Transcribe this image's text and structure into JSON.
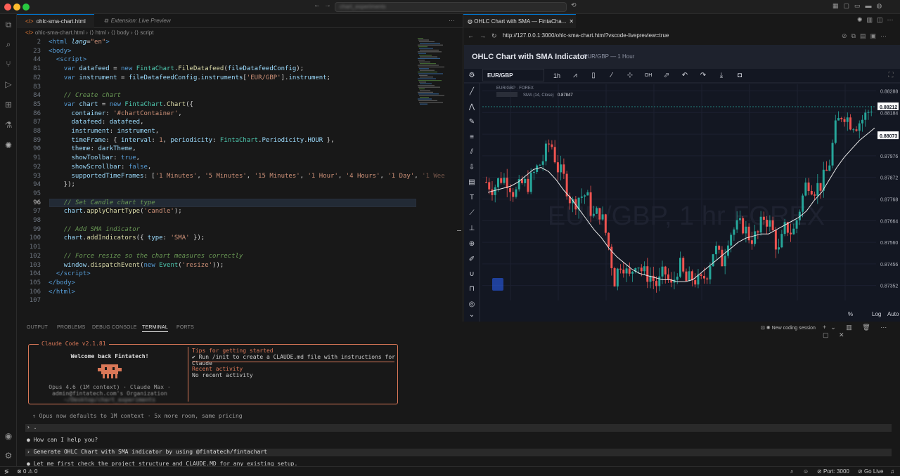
{
  "titlebar": {
    "search_text": "chart_experiments"
  },
  "editor": {
    "tabs": [
      {
        "label": "ohlc-sma-chart.html"
      },
      {
        "label": "Extension: Live Preview"
      }
    ],
    "breadcrumb": {
      "file": "ohlc-sma-chart.html",
      "html": "html",
      "body": "body",
      "script": "script"
    },
    "line_numbers": [
      "2",
      "23",
      "44",
      "81",
      "82",
      "83",
      "84",
      "85",
      "86",
      "87",
      "88",
      "89",
      "90",
      "91",
      "92",
      "93",
      "94",
      "95",
      "96",
      "97",
      "98",
      "99",
      "100",
      "101",
      "102",
      "103",
      "104",
      "105",
      "106",
      "107"
    ]
  },
  "panel": {
    "tabs": [
      "OUTPUT",
      "PROBLEMS",
      "DEBUG CONSOLE",
      "TERMINAL",
      "PORTS"
    ],
    "active_tab": "TERMINAL",
    "session_label": "New coding session"
  },
  "terminal": {
    "box_title": "Claude Code v2.1.81",
    "welcome": "Welcome back Fintatech!",
    "model": "Opus 4.6 (1M context) · Claude Max ·",
    "org": "admin@fintatech.com's Organization",
    "path": "~/Desktop/chart_experiments",
    "tips_title": "Tips for getting started",
    "tips_line": "✔ Run /init to create a CLAUDE.md file with instructions for Claude",
    "recent_title": "Recent activity",
    "recent_line": "No recent activity",
    "notice": "↑ Opus now defaults to 1M context · 5x more room, same pricing",
    "prompt_dot": "›  .",
    "q1": "●  How can I help you?",
    "prompt2": "›  Generate OHLC Chart with SMA indicator by using @fintatech/fintachart",
    "a1": "●  Let me first check the project structure and CLAUDE.MD for any existing setup."
  },
  "preview": {
    "tab_label": "OHLC Chart with SMA — FintaCha...",
    "url": "http://127.0.0.1:3000/ohlc-sma-chart.html?vscode-livepreview=true",
    "page_title": "OHLC Chart with SMA Indicator",
    "page_sub": "EUR/GBP — 1 Hour"
  },
  "chart_data": {
    "type": "candlestick",
    "symbol": "EUR/GBP",
    "timeframe": "1h",
    "legend_title": "EUR/GBP · FOREX",
    "indicator_label": "SMA (14, Close)",
    "indicator_value": "0.87847",
    "watermark": "EUR/GBP, 1 hr FOREX",
    "y_ticks": [
      "0.88288",
      "0.88184",
      "0.88080",
      "0.87976",
      "0.87872",
      "0.87768",
      "0.87664",
      "0.87560",
      "0.87456",
      "0.87352"
    ],
    "y_ticks_visible": [
      "0.88288",
      "0.88184",
      "0.87976",
      "0.87872",
      "0.87768",
      "0.87664",
      "0.87560",
      "0.87456",
      "0.87352"
    ],
    "last_price": "0.88212",
    "cursor_price": "0.88073",
    "ylim": [
      0.8728,
      0.8832
    ],
    "scale_buttons": [
      "%",
      "Log",
      "Auto"
    ],
    "close_path": [
      0.8785,
      0.8782,
      0.8787,
      0.8786,
      0.8779,
      0.8784,
      0.8784,
      0.8791,
      0.8796,
      0.8805,
      0.8792,
      0.8786,
      0.8774,
      0.8778,
      0.8779,
      0.8768,
      0.8771,
      0.8757,
      0.8738,
      0.8748,
      0.8738,
      0.8748,
      0.8741,
      0.874,
      0.8735,
      0.8742,
      0.8734,
      0.8746,
      0.8737,
      0.8739,
      0.8736,
      0.8742,
      0.8754,
      0.8746,
      0.876,
      0.8763,
      0.8764,
      0.8758,
      0.8759,
      0.8769,
      0.8763,
      0.8751,
      0.8764,
      0.876,
      0.8773,
      0.8786,
      0.8782,
      0.8784,
      0.8792,
      0.8811,
      0.8819,
      0.8814,
      0.8813,
      0.8816,
      0.8821
    ],
    "sma_path": [
      0.878,
      0.8781,
      0.8782,
      0.8783,
      0.8785,
      0.8788,
      0.8791,
      0.8792,
      0.879,
      0.8786,
      0.8781,
      0.8777,
      0.8772,
      0.8767,
      0.8762,
      0.8758,
      0.8753,
      0.8749,
      0.8746,
      0.8743,
      0.8741,
      0.874,
      0.8739,
      0.8738,
      0.8738,
      0.8737,
      0.8737,
      0.8738,
      0.8741,
      0.8744,
      0.8747,
      0.875,
      0.8753,
      0.8756,
      0.8758,
      0.8759,
      0.876,
      0.876,
      0.8762,
      0.8764,
      0.8766,
      0.8768,
      0.8771,
      0.8776,
      0.878,
      0.8786,
      0.8792,
      0.8797,
      0.8801,
      0.8805,
      0.8808,
      0.8811
    ]
  },
  "status": {
    "errors": "0",
    "warnings": "0",
    "port": "Port: 3000",
    "golive": "Go Live"
  }
}
